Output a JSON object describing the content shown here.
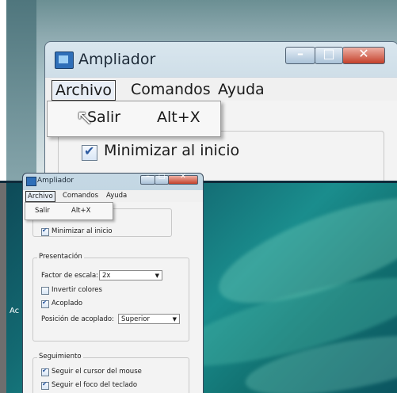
{
  "magnified": {
    "title": "Ampliador",
    "menu": [
      "Archivo",
      "Comandos",
      "Ayuda"
    ],
    "dropdown": {
      "item": "Salir",
      "shortcut": "Alt+X"
    },
    "checkbox_label": "Minimizar al inicio"
  },
  "window": {
    "title": "Ampliador",
    "menu": [
      "Archivo",
      "Comandos",
      "Ayuda"
    ],
    "dropdown": {
      "item": "Salir",
      "shortcut": "Alt+X"
    },
    "minimize_label": "Minimizar al inicio",
    "presentacion": {
      "title": "Presentación",
      "scale_label": "Factor de escala:",
      "scale_value": "2x",
      "invert_label": "Invertir colores",
      "docked_label": "Acoplado",
      "dock_pos_label": "Posición de acoplado:",
      "dock_pos_value": "Superior"
    },
    "seguimiento": {
      "title": "Seguimiento",
      "mouse_label": "Seguir el cursor del mouse",
      "keyboard_label": "Seguir el foco del teclado"
    }
  },
  "desktop_fragment": "Ac"
}
